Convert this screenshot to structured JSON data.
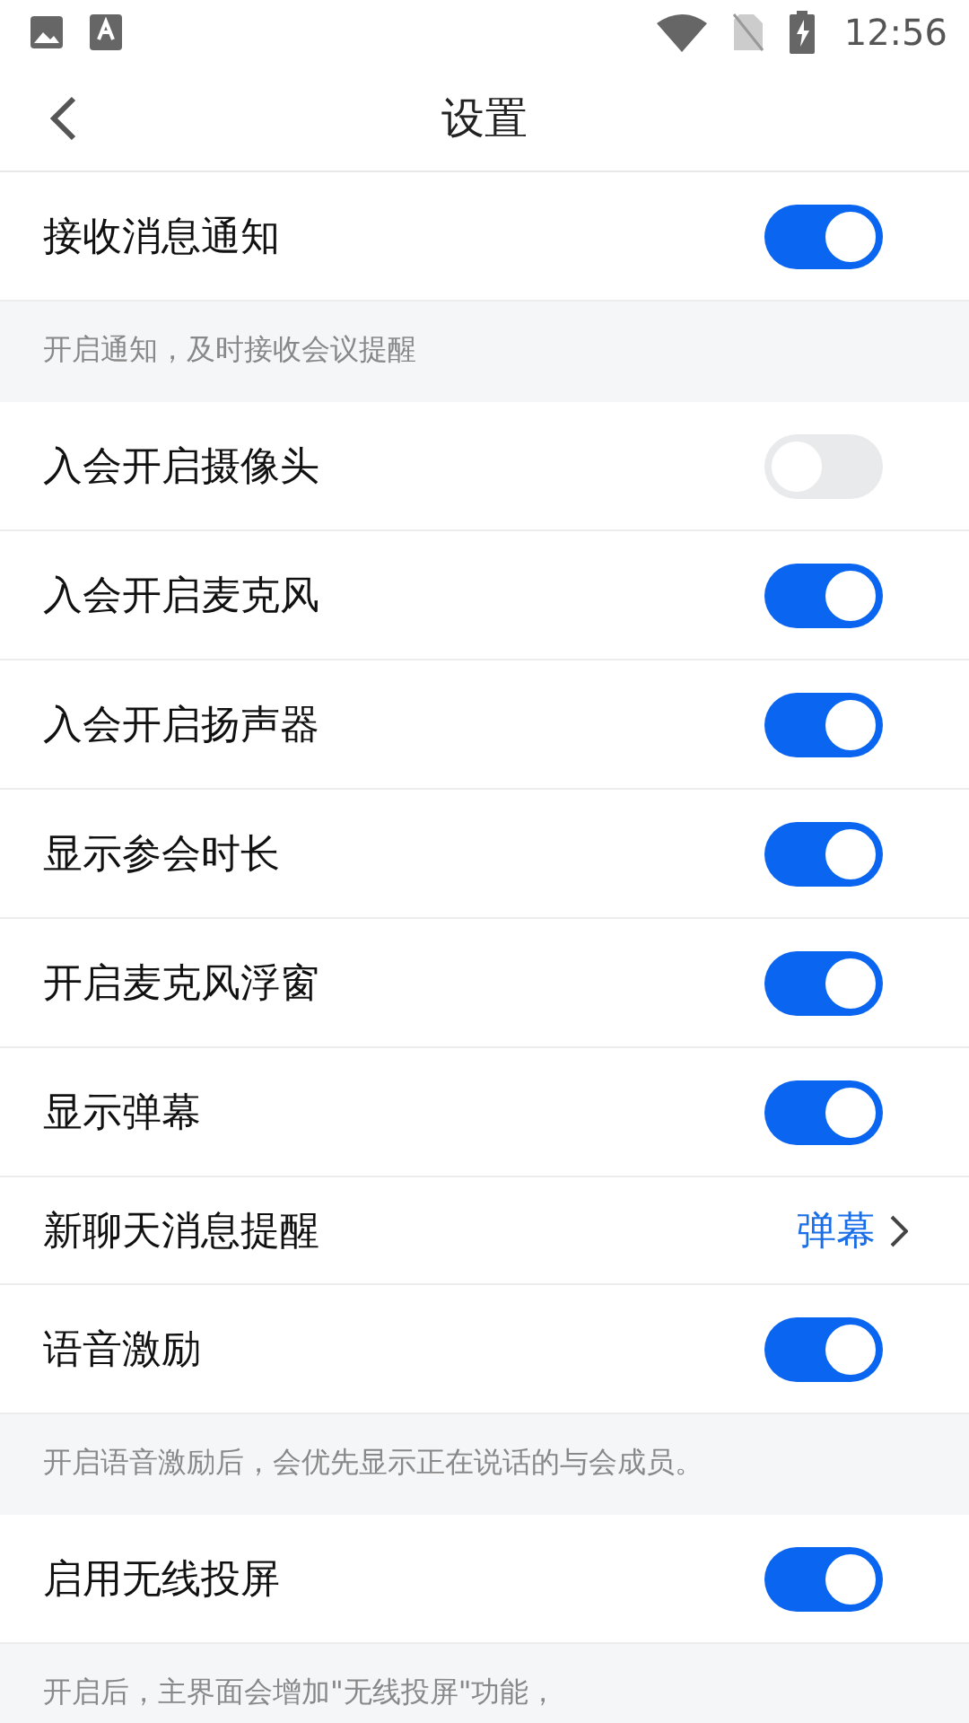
{
  "status_bar": {
    "time": "12:56"
  },
  "header": {
    "title": "设置"
  },
  "sections": [
    {
      "kind": "toggle",
      "label": "接收消息通知",
      "on": true
    },
    {
      "kind": "note",
      "text": "开启通知，及时接收会议提醒"
    },
    {
      "kind": "toggle",
      "label": "入会开启摄像头",
      "on": false
    },
    {
      "kind": "toggle",
      "label": "入会开启麦克风",
      "on": true
    },
    {
      "kind": "toggle",
      "label": "入会开启扬声器",
      "on": true
    },
    {
      "kind": "toggle",
      "label": "显示参会时长",
      "on": true
    },
    {
      "kind": "toggle",
      "label": "开启麦克风浮窗",
      "on": true
    },
    {
      "kind": "toggle",
      "label": "显示弹幕",
      "on": true
    },
    {
      "kind": "link",
      "label": "新聊天消息提醒",
      "value": "弹幕"
    },
    {
      "kind": "toggle",
      "label": "语音激励",
      "on": true
    },
    {
      "kind": "note",
      "text": "开启语音激励后，会优先显示正在说话的与会成员。"
    },
    {
      "kind": "toggle",
      "label": "启用无线投屏",
      "on": true
    },
    {
      "kind": "note",
      "text": "开启后，主界面会增加\"无线投屏\"功能，"
    }
  ]
}
